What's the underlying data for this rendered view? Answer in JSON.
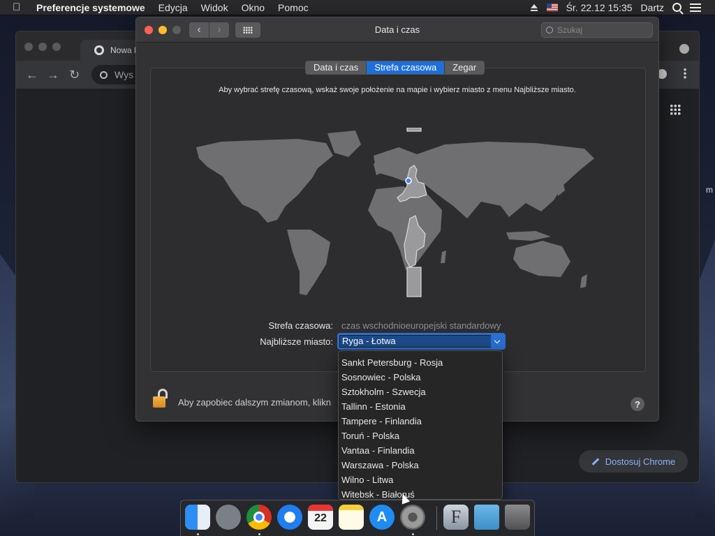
{
  "menubar": {
    "app_name": "Preferencje systemowe",
    "menus": [
      "Edycja",
      "Widok",
      "Okno",
      "Pomoc"
    ],
    "datetime": "Śr. 22.12  15:35",
    "user": "Dartz",
    "icons": [
      "apple-icon",
      "eject-icon",
      "us-flag-icon",
      "search-icon",
      "notification-list-icon"
    ]
  },
  "chrome": {
    "tab_title": "Nowa kart",
    "omnibox_placeholder": "Wys",
    "customize_label": "Dostosuj Chrome",
    "edge_text": "m"
  },
  "prefs": {
    "title": "Data i czas",
    "search_placeholder": "Szukaj",
    "tabs": [
      {
        "label": "Data i czas",
        "active": false
      },
      {
        "label": "Strefa czasowa",
        "active": true
      },
      {
        "label": "Zegar",
        "active": false
      }
    ],
    "instruction": "Aby wybrać strefę czasową, wskaż swoje położenie na mapie i wybierz miasto z menu Najbliższe miasto.",
    "timezone_label": "Strefa czasowa:",
    "timezone_value": "czas wschodnioeuropejski standardowy",
    "city_label": "Najbliższe miasto:",
    "city_value": "Ryga - Łotwa",
    "lock_text": "Aby zapobiec dalszym zmianom, klikn",
    "help_label": "?"
  },
  "dropdown": {
    "items": [
      "Sankt Petersburg - Rosja",
      "Sosnowiec - Polska",
      "Sztokholm - Szwecja",
      "Tallinn - Estonia",
      "Tampere - Finlandia",
      "Toruń - Polska",
      "Vantaa - Finlandia",
      "Warszawa - Polska",
      "Wilno - Litwa",
      "Witebsk - Białoruś"
    ]
  },
  "dock": {
    "calendar_month": "GRU",
    "calendar_day": "22",
    "apps": [
      "finder",
      "launchpad",
      "chrome",
      "safari",
      "calendar",
      "notes",
      "app-store",
      "system-preferences",
      "font-book",
      "downloads-folder",
      "trash"
    ]
  },
  "colors": {
    "accent": "#1e6fd9",
    "window_bg": "#323234",
    "map_land": "#6f6f71",
    "map_highlight": "#9a9a9c"
  }
}
